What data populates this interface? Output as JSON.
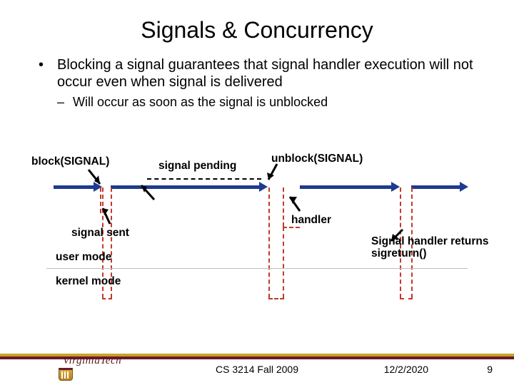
{
  "title": "Signals & Concurrency",
  "bullets": {
    "b1": "Blocking a signal guarantees that signal handler execution will not occur even when signal is delivered",
    "b2": "Will occur as soon as the signal is unblocked"
  },
  "labels": {
    "block": "block(SIGNAL)",
    "unblock": "unblock(SIGNAL)",
    "pending": "signal pending",
    "sent": "signal sent",
    "handler": "handler",
    "user": "user mode",
    "kernel": "kernel mode",
    "returns_l1": "Signal handler returns",
    "returns_l2": "sigreturn()"
  },
  "footer": {
    "course": "CS 3214 Fall 2009",
    "date": "12/2/2020",
    "page": "9"
  },
  "logo": {
    "text": "VirginiaTech"
  }
}
